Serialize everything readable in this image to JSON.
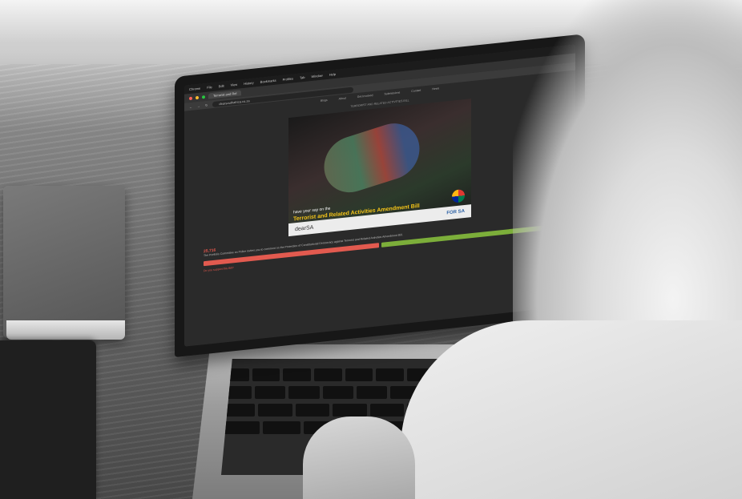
{
  "browser": {
    "app_menu": [
      "Chrome",
      "File",
      "Edit",
      "View",
      "History",
      "Bookmarks",
      "Profiles",
      "Tab",
      "Window",
      "Help"
    ],
    "tab_title": "Terrorist and Rel",
    "url": "dearsouthafrica.co.za"
  },
  "site": {
    "nav": [
      "Blogs",
      "About",
      "Get Involved",
      "Submissions",
      "Contact",
      "News"
    ],
    "kicker": "TERRORIST AND RELATED ACTIVITIES BILL"
  },
  "hero": {
    "caption": "have your say on the",
    "bill_title": "Terrorist and Related Activities Amendment Bill",
    "logo_left": "dearSA",
    "logo_right": "FOR SA"
  },
  "body": {
    "count": "25,716",
    "intro": "The Portfolio Committee on Police invites you to comment on the Protection of Constitutional Democracy against Terrorist and Related Activities Amendment Bill.",
    "section_heading": "Do you support this Bill?"
  },
  "colors": {
    "no": "#e25a4f",
    "yes": "#7cae3a",
    "accent": "#e2574c"
  }
}
